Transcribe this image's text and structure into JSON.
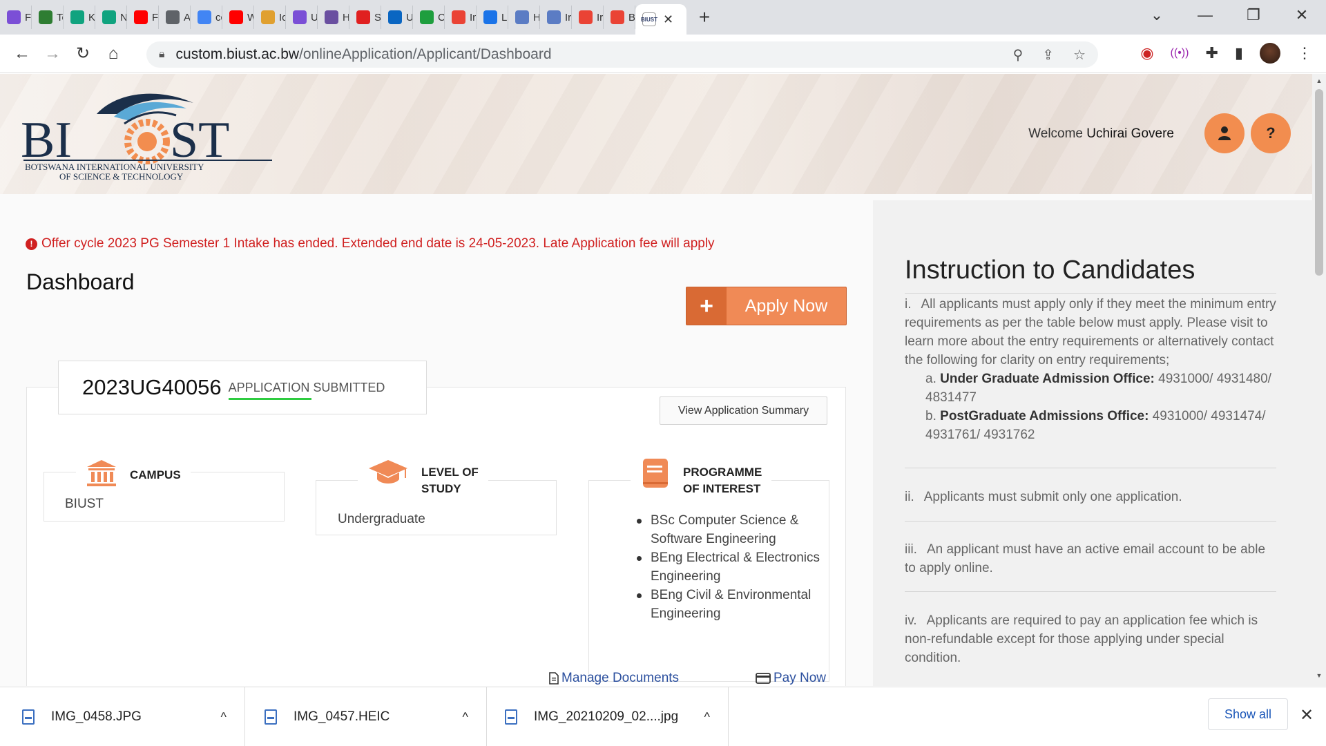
{
  "browser": {
    "tabs": [
      {
        "icon": "u-icon",
        "label": "Fi",
        "color": "#7b4fd6"
      },
      {
        "icon": "v-icon",
        "label": "To",
        "color": "#2e7d32"
      },
      {
        "icon": "chatgpt-icon",
        "label": "K",
        "color": "#10a37f"
      },
      {
        "icon": "chatgpt-icon",
        "label": "N",
        "color": "#10a37f"
      },
      {
        "icon": "youtube-icon",
        "label": "Fo",
        "color": "#ff0000"
      },
      {
        "icon": "globe-icon",
        "label": "A",
        "color": "#5f6368"
      },
      {
        "icon": "google-icon",
        "label": "cc",
        "color": "#4285f4"
      },
      {
        "icon": "youtube-icon",
        "label": "W",
        "color": "#ff0000"
      },
      {
        "icon": "pma-icon",
        "label": "Io",
        "color": "#e0a030"
      },
      {
        "icon": "u-icon",
        "label": "U",
        "color": "#7b4fd6"
      },
      {
        "icon": "h-icon",
        "label": "H",
        "color": "#6a4fa0"
      },
      {
        "icon": "g-icon",
        "label": "St",
        "color": "#e02020"
      },
      {
        "icon": "linkedin-icon",
        "label": "U",
        "color": "#0a66c2"
      },
      {
        "icon": "code-icon",
        "label": "C",
        "color": "#1e9e3e"
      },
      {
        "icon": "gmail-icon",
        "label": "In",
        "color": "#ea4335"
      },
      {
        "icon": "info-icon",
        "label": "Le",
        "color": "#1a73e8"
      },
      {
        "icon": "bird-icon",
        "label": "H",
        "color": "#5b7cc4"
      },
      {
        "icon": "bird-icon",
        "label": "Ir",
        "color": "#5b7cc4"
      },
      {
        "icon": "gmail-icon",
        "label": "Ir",
        "color": "#ea4335"
      },
      {
        "icon": "gmail-icon",
        "label": "B",
        "color": "#ea4335"
      }
    ],
    "active_tab_icon": "biust-icon",
    "active_tab_close": "✕",
    "new_tab": "+",
    "url_host": "custom.biust.ac.bw",
    "url_path": "/onlineApplication/Applicant/Dashboard",
    "window_controls": [
      "⌄",
      "—",
      "❐",
      "✕"
    ]
  },
  "header": {
    "logo_lines": [
      "BOTSWANA INTERNATIONAL UNIVERSITY",
      "OF SCIENCE & TECHNOLOGY"
    ],
    "logo_letters": [
      "BI",
      "ST"
    ],
    "welcome_prefix": "Welcome",
    "user_name": "Uchirai Govere",
    "help_glyph": "?"
  },
  "alert": {
    "text": "Offer cycle 2023 PG Semester 1 Intake has ended. Extended end date is 24-05-2023. Late Application fee will apply",
    "color": "#d02020"
  },
  "dashboard": {
    "title": "Dashboard",
    "apply_button": "Apply Now",
    "apply_plus": "+",
    "application_id": "2023UG40056",
    "application_status": "APPLICATION SUBMITTED",
    "view_summary_button": "View Application Summary",
    "campus_label": "CAMPUS",
    "campus_value": "BIUST",
    "level_label_1": "LEVEL OF",
    "level_label_2": "STUDY",
    "level_value": "Undergraduate",
    "programme_label_1": "PROGRAMME",
    "programme_label_2": "OF INTEREST",
    "programmes": [
      "BSc Computer Science & Software Engineering",
      "BEng Electrical & Electronics Engineering",
      "BEng Civil & Environmental Engineering"
    ],
    "manage_documents": "Manage Documents",
    "pay_now": "Pay Now",
    "accent_color": "#f08a56"
  },
  "instructions": {
    "title": "Instruction to Candidates",
    "item1_num": "i.",
    "item1_text": "All applicants must apply only if they meet the minimum entry requirements as per the table below must apply. Please visit to learn more about the entry requirements or alternatively contact the following for clarity on entry requirements;",
    "item1a_prefix": "a.",
    "item1a_label": "Under Graduate Admission Office:",
    "item1a_value": "4931000/ 4931480/ 4831477",
    "item1b_prefix": "b.",
    "item1b_label": "PostGraduate Admissions Office:",
    "item1b_value": "4931000/ 4931474/ 4931761/ 4931762",
    "item2_num": "ii.",
    "item2_text": "Applicants must submit only one application.",
    "item3_num": "iii.",
    "item3_text": "An applicant must have an active email account to be able to apply online.",
    "item4_num": "iv.",
    "item4_text": "Applicants are required to pay an application fee which is non-refundable except for those applying under special condition."
  },
  "downloads": {
    "items": [
      "IMG_0458.JPG",
      "IMG_0457.HEIC",
      "IMG_20210209_02....jpg"
    ],
    "chevron": "^",
    "show_all": "Show all",
    "close": "✕"
  }
}
